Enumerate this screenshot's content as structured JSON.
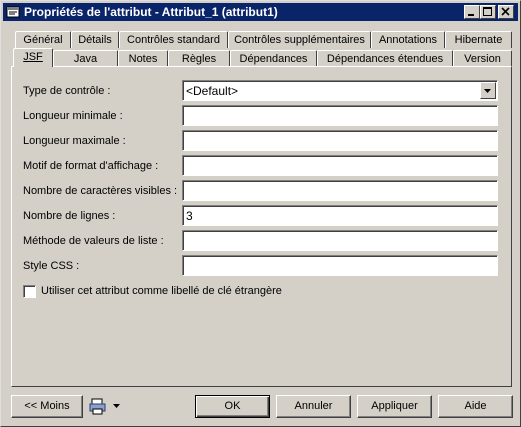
{
  "window": {
    "title": "Propriétés de l'attribut - Attribut_1 (attribut1)"
  },
  "tabs_row1": [
    "Général",
    "Détails",
    "Contrôles standard",
    "Contrôles supplémentaires",
    "Annotations",
    "Hibernate"
  ],
  "tabs_row2": [
    "JSF",
    "Java",
    "Notes",
    "Règles",
    "Dépendances",
    "Dépendances étendues",
    "Version"
  ],
  "active_tab": "JSF",
  "form": {
    "type_label": "Type de contrôle :",
    "type_value": "<Default>",
    "min_length_label": "Longueur minimale :",
    "min_length_value": "",
    "max_length_label": "Longueur maximale :",
    "max_length_value": "",
    "format_label": "Motif de format d'affichage :",
    "format_value": "",
    "visible_chars_label": "Nombre de caractères visibles :",
    "visible_chars_value": "",
    "rows_label": "Nombre de lignes :",
    "rows_value": "3",
    "list_method_label": "Méthode de valeurs de liste :",
    "list_method_value": "",
    "css_label": "Style CSS :",
    "css_value": "",
    "fk_checkbox_label": "Utiliser cet attribut comme libellé de clé étrangère",
    "fk_checked": false
  },
  "buttons": {
    "less": "<< Moins",
    "ok": "OK",
    "cancel": "Annuler",
    "apply": "Appliquer",
    "help": "Aide"
  }
}
